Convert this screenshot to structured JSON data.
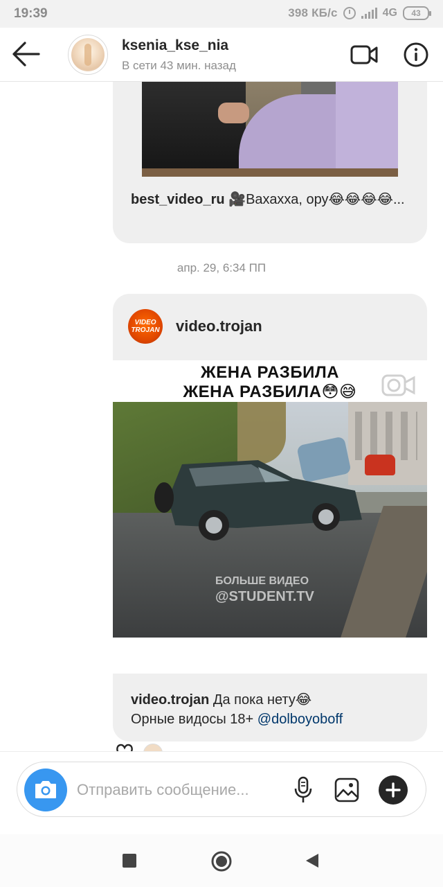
{
  "status_bar": {
    "time": "19:39",
    "net_speed": "398 КБ/с",
    "network": "4G",
    "battery": "43"
  },
  "header": {
    "username": "ksenia_kse_nia",
    "status": "В сети 43 мин. назад",
    "icons": [
      "back-arrow-icon",
      "video-call-icon",
      "info-icon"
    ]
  },
  "messages": {
    "shared_post_1": {
      "author": "best_video_ru",
      "caption": "🎥Вахахха, ору😂😂😂😂..."
    },
    "date_separator": "апр. 29, 6:34 ПП",
    "shared_post_2": {
      "author": "video.trojan",
      "avatar_text": "VIDEO TROJAN",
      "post_caption_line1": "ЖЕНА РАЗБИЛА",
      "post_caption_line2": "ЖЕНА РАЗБИЛА😳😅",
      "watermark_line1": "БОЛЬШЕ ВИДЕО",
      "watermark_line2": "@STUDENT.TV",
      "footer_author": "video.trojan",
      "footer_text": "Да пока нету😂",
      "footer_line2": "Орные видосы 18+ ",
      "footer_mention": "@dolboyoboff"
    }
  },
  "composer": {
    "placeholder": "Отправить сообщение...",
    "icons": [
      "camera-icon",
      "microphone-icon",
      "gallery-icon",
      "plus-icon"
    ]
  },
  "navigation": {
    "icons": [
      "recent-apps-icon",
      "home-icon",
      "back-triangle-icon"
    ]
  },
  "colors": {
    "accent_blue": "#3897f0",
    "bubble_gray": "#efefef",
    "mention": "#00376b",
    "secondary_text": "#8e8e8e"
  }
}
